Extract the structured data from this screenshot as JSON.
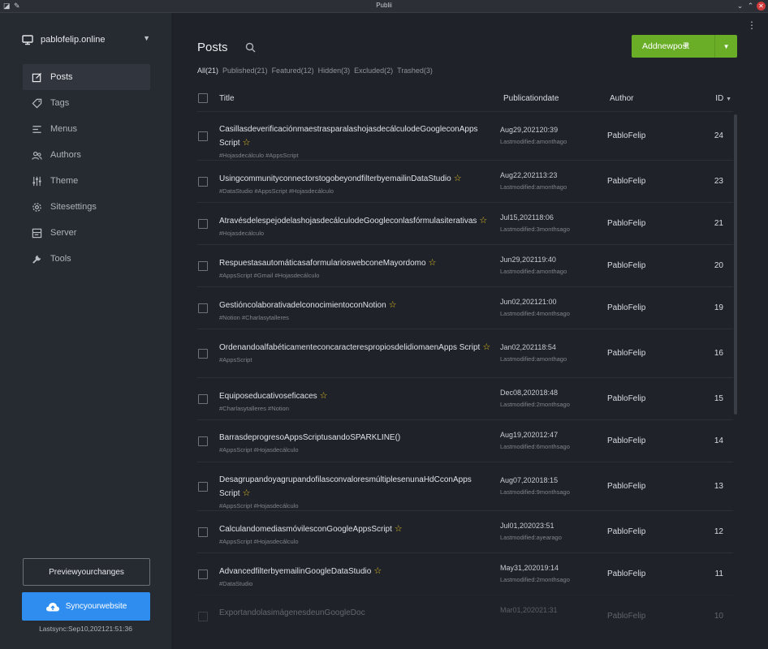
{
  "window": {
    "title": "Publii"
  },
  "sidebar": {
    "site_name": "pablofelip.online",
    "items": [
      {
        "label": "Posts",
        "icon": "posts-icon",
        "active": true
      },
      {
        "label": "Tags",
        "icon": "tag-icon",
        "active": false
      },
      {
        "label": "Menus",
        "icon": "menu-icon",
        "active": false
      },
      {
        "label": "Authors",
        "icon": "authors-icon",
        "active": false
      },
      {
        "label": "Theme",
        "icon": "sliders-icon",
        "active": false
      },
      {
        "label": "Sitesettings",
        "icon": "gear-icon",
        "active": false
      },
      {
        "label": "Server",
        "icon": "server-icon",
        "active": false
      },
      {
        "label": "Tools",
        "icon": "wrench-icon",
        "active": false
      }
    ],
    "preview_label": "Previewyourchanges",
    "sync_label": "Syncyourwebsite",
    "last_sync": "Lastsync:Sep10,202121:51:36"
  },
  "main": {
    "title": "Posts",
    "add_label": "Addnewpost",
    "filters": [
      {
        "label": "All(21)",
        "active": true
      },
      {
        "label": "Published(21)",
        "active": false
      },
      {
        "label": "Featured(12)",
        "active": false
      },
      {
        "label": "Hidden(3)",
        "active": false
      },
      {
        "label": "Excluded(2)",
        "active": false
      },
      {
        "label": "Trashed(3)",
        "active": false
      }
    ],
    "columns": {
      "title": "Title",
      "date": "Publicationdate",
      "author": "Author",
      "id": "ID"
    },
    "posts": [
      {
        "title": "CasillasdeverificaciónmaestrasparalashojasdecálculodeGoogleconApps Script",
        "featured": true,
        "tags": "#Hojasdecálculo  #AppsScript",
        "date": "Aug29,202120:39",
        "modified": "Lastmodified:amonthago",
        "author": "PabloFelip",
        "id": "24",
        "lines": 2
      },
      {
        "title": "UsingcommunityconnectorstogobeyondfilterbyemailinDataStudio",
        "featured": true,
        "tags": "#DataStudio  #AppsScript  #Hojasdecálculo",
        "date": "Aug22,202113:23",
        "modified": "Lastmodified:amonthago",
        "author": "PabloFelip",
        "id": "23",
        "lines": 1
      },
      {
        "title": "AtravésdelespejodelashojasdecálculodeGoogleconlasfórmulasiterativas",
        "featured": true,
        "tags": "#Hojasdecálculo",
        "date": "Jul15,202118:06",
        "modified": "Lastmodified:3monthsago",
        "author": "PabloFelip",
        "id": "21",
        "lines": 1
      },
      {
        "title": "RespuestasautomáticasaformularioswebconeMayordomo",
        "featured": true,
        "tags": "#AppsScript  #Gmail  #Hojasdecálculo",
        "date": "Jun29,202119:40",
        "modified": "Lastmodified:amonthago",
        "author": "PabloFelip",
        "id": "20",
        "lines": 1
      },
      {
        "title": "GestióncolaborativadelconocimientoconNotion",
        "featured": true,
        "tags": "#Notion  #Charlasytalleres",
        "date": "Jun02,202121:00",
        "modified": "Lastmodified:4monthsago",
        "author": "PabloFelip",
        "id": "19",
        "lines": 1
      },
      {
        "title": "OrdenandoalfabéticamenteconcaracterespropiosdelidiomaenApps Script",
        "featured": true,
        "tags": "#AppsScript",
        "date": "Jan02,202118:54",
        "modified": "Lastmodified:amonthago",
        "author": "PabloFelip",
        "id": "16",
        "lines": 2
      },
      {
        "title": "Equiposeducativoseficaces",
        "featured": true,
        "tags": "#Charlasytalleres  #Notion",
        "date": "Dec08,202018:48",
        "modified": "Lastmodified:2monthsago",
        "author": "PabloFelip",
        "id": "15",
        "lines": 1
      },
      {
        "title": "BarrasdeprogresoAppsScriptusandoSPARKLINE()",
        "featured": false,
        "tags": "#AppsScript  #Hojasdecálculo",
        "date": "Aug19,202012:47",
        "modified": "Lastmodified:6monthsago",
        "author": "PabloFelip",
        "id": "14",
        "lines": 1
      },
      {
        "title": "DesagrupandoyagrupandofilasconvaloresmúltiplesenunaHdCconApps Script",
        "featured": true,
        "tags": "#AppsScript  #Hojasdecálculo",
        "date": "Aug07,202018:15",
        "modified": "Lastmodified:9monthsago",
        "author": "PabloFelip",
        "id": "13",
        "lines": 2
      },
      {
        "title": "CalculandomediasmóvilesconGoogleAppsScript",
        "featured": true,
        "tags": "#AppsScript  #Hojasdecálculo",
        "date": "Jul01,202023:51",
        "modified": "Lastmodified:ayearago",
        "author": "PabloFelip",
        "id": "12",
        "lines": 1
      },
      {
        "title": "AdvancedfilterbyemailinGoogleDataStudio",
        "featured": true,
        "tags": "#DataStudio",
        "date": "May31,202019:14",
        "modified": "Lastmodified:2monthsago",
        "author": "PabloFelip",
        "id": "11",
        "lines": 1
      },
      {
        "title": "ExportandolasimágenesdeunGoogleDoc",
        "featured": false,
        "tags": "",
        "date": "Mar01,202021:31",
        "modified": "",
        "author": "PabloFelip",
        "id": "10",
        "lines": 1
      }
    ]
  },
  "colors": {
    "accent_green": "#6aae27",
    "accent_blue": "#2f8df0",
    "star": "#e9c21f"
  }
}
